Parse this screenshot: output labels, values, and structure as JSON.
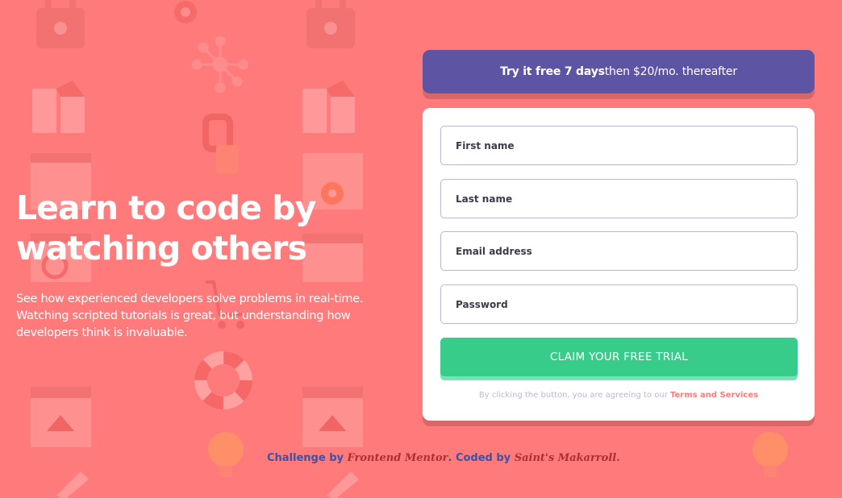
{
  "hero": {
    "title_line1": "Learn to code by",
    "title_line2": "watching others",
    "description": "See how experienced developers solve problems in real-time. Watching scripted tutorials is great, but understanding how developers think is invaluable."
  },
  "promo": {
    "bold": "Try it free 7 days",
    "rest": "then $20/mo. thereafter"
  },
  "form": {
    "first_name_placeholder": "First name",
    "last_name_placeholder": "Last name",
    "email_placeholder": "Email address",
    "password_placeholder": "Password",
    "submit_label": "CLAIM YOUR FREE TRIAL",
    "terms_prefix": "By clicking the button, you are agreeing to our ",
    "terms_link": "Terms and Services"
  },
  "footer": {
    "challenge_by": "Challenge by ",
    "frontend_mentor": "Frontend Mentor",
    "coded_by": ". Coded by ",
    "author": "Saint's Makarroll."
  },
  "colors": {
    "background": "#ff7a7a",
    "promo": "#5e54a4",
    "cta": "#38cc8b"
  },
  "icons": [
    "padlock-icon",
    "network-icon",
    "gear-icon",
    "browser-window-icon",
    "lifebuoy-icon",
    "lightbulb-icon",
    "rocket-icon",
    "cart-icon"
  ]
}
